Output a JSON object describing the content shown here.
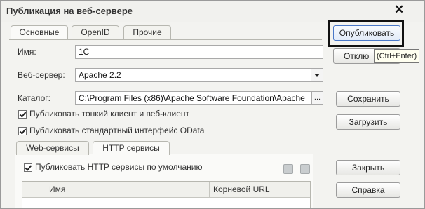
{
  "window": {
    "title": "Публикация на веб-сервере",
    "close_glyph": "✕"
  },
  "tabs": [
    {
      "label": "Основные",
      "active": true
    },
    {
      "label": "OpenID",
      "active": false
    },
    {
      "label": "Прочие",
      "active": false
    }
  ],
  "form": {
    "name_label": "Имя:",
    "name_value": "1С",
    "webserver_label": "Веб-сервер:",
    "webserver_value": "Apache 2.2",
    "catalog_label": "Каталог:",
    "catalog_value": "C:\\Program Files (x86)\\Apache Software Foundation\\Apache",
    "catalog_button": "...",
    "publish_thin_client": {
      "label": "Публиковать тонкий клиент и веб-клиент",
      "checked": true
    },
    "publish_odata": {
      "label": "Публиковать стандартный интерфейс OData",
      "checked": true
    }
  },
  "subtabs": [
    {
      "label": "Web-сервисы",
      "active": false
    },
    {
      "label": "HTTP сервисы",
      "active": true
    }
  ],
  "http_services": {
    "publish_default": {
      "label": "Публиковать HTTP сервисы по умолчанию",
      "checked": true
    },
    "columns": [
      "Имя",
      "Корневой URL"
    ]
  },
  "buttons": {
    "publish": "Опубликовать",
    "disable": "Отклю",
    "save": "Сохранить",
    "load": "Загрузить",
    "close": "Закрыть",
    "help": "Справка"
  },
  "tooltip": "(Ctrl+Enter)",
  "icons": {
    "close": "close-icon",
    "dropdown": "chevron-down-icon",
    "toolbar": [
      "check-all-icon",
      "uncheck-all-icon"
    ]
  },
  "colors": {
    "highlight_border": "#111111",
    "primary_border": "#4a78c8",
    "tooltip_bg": "#fffff0"
  }
}
